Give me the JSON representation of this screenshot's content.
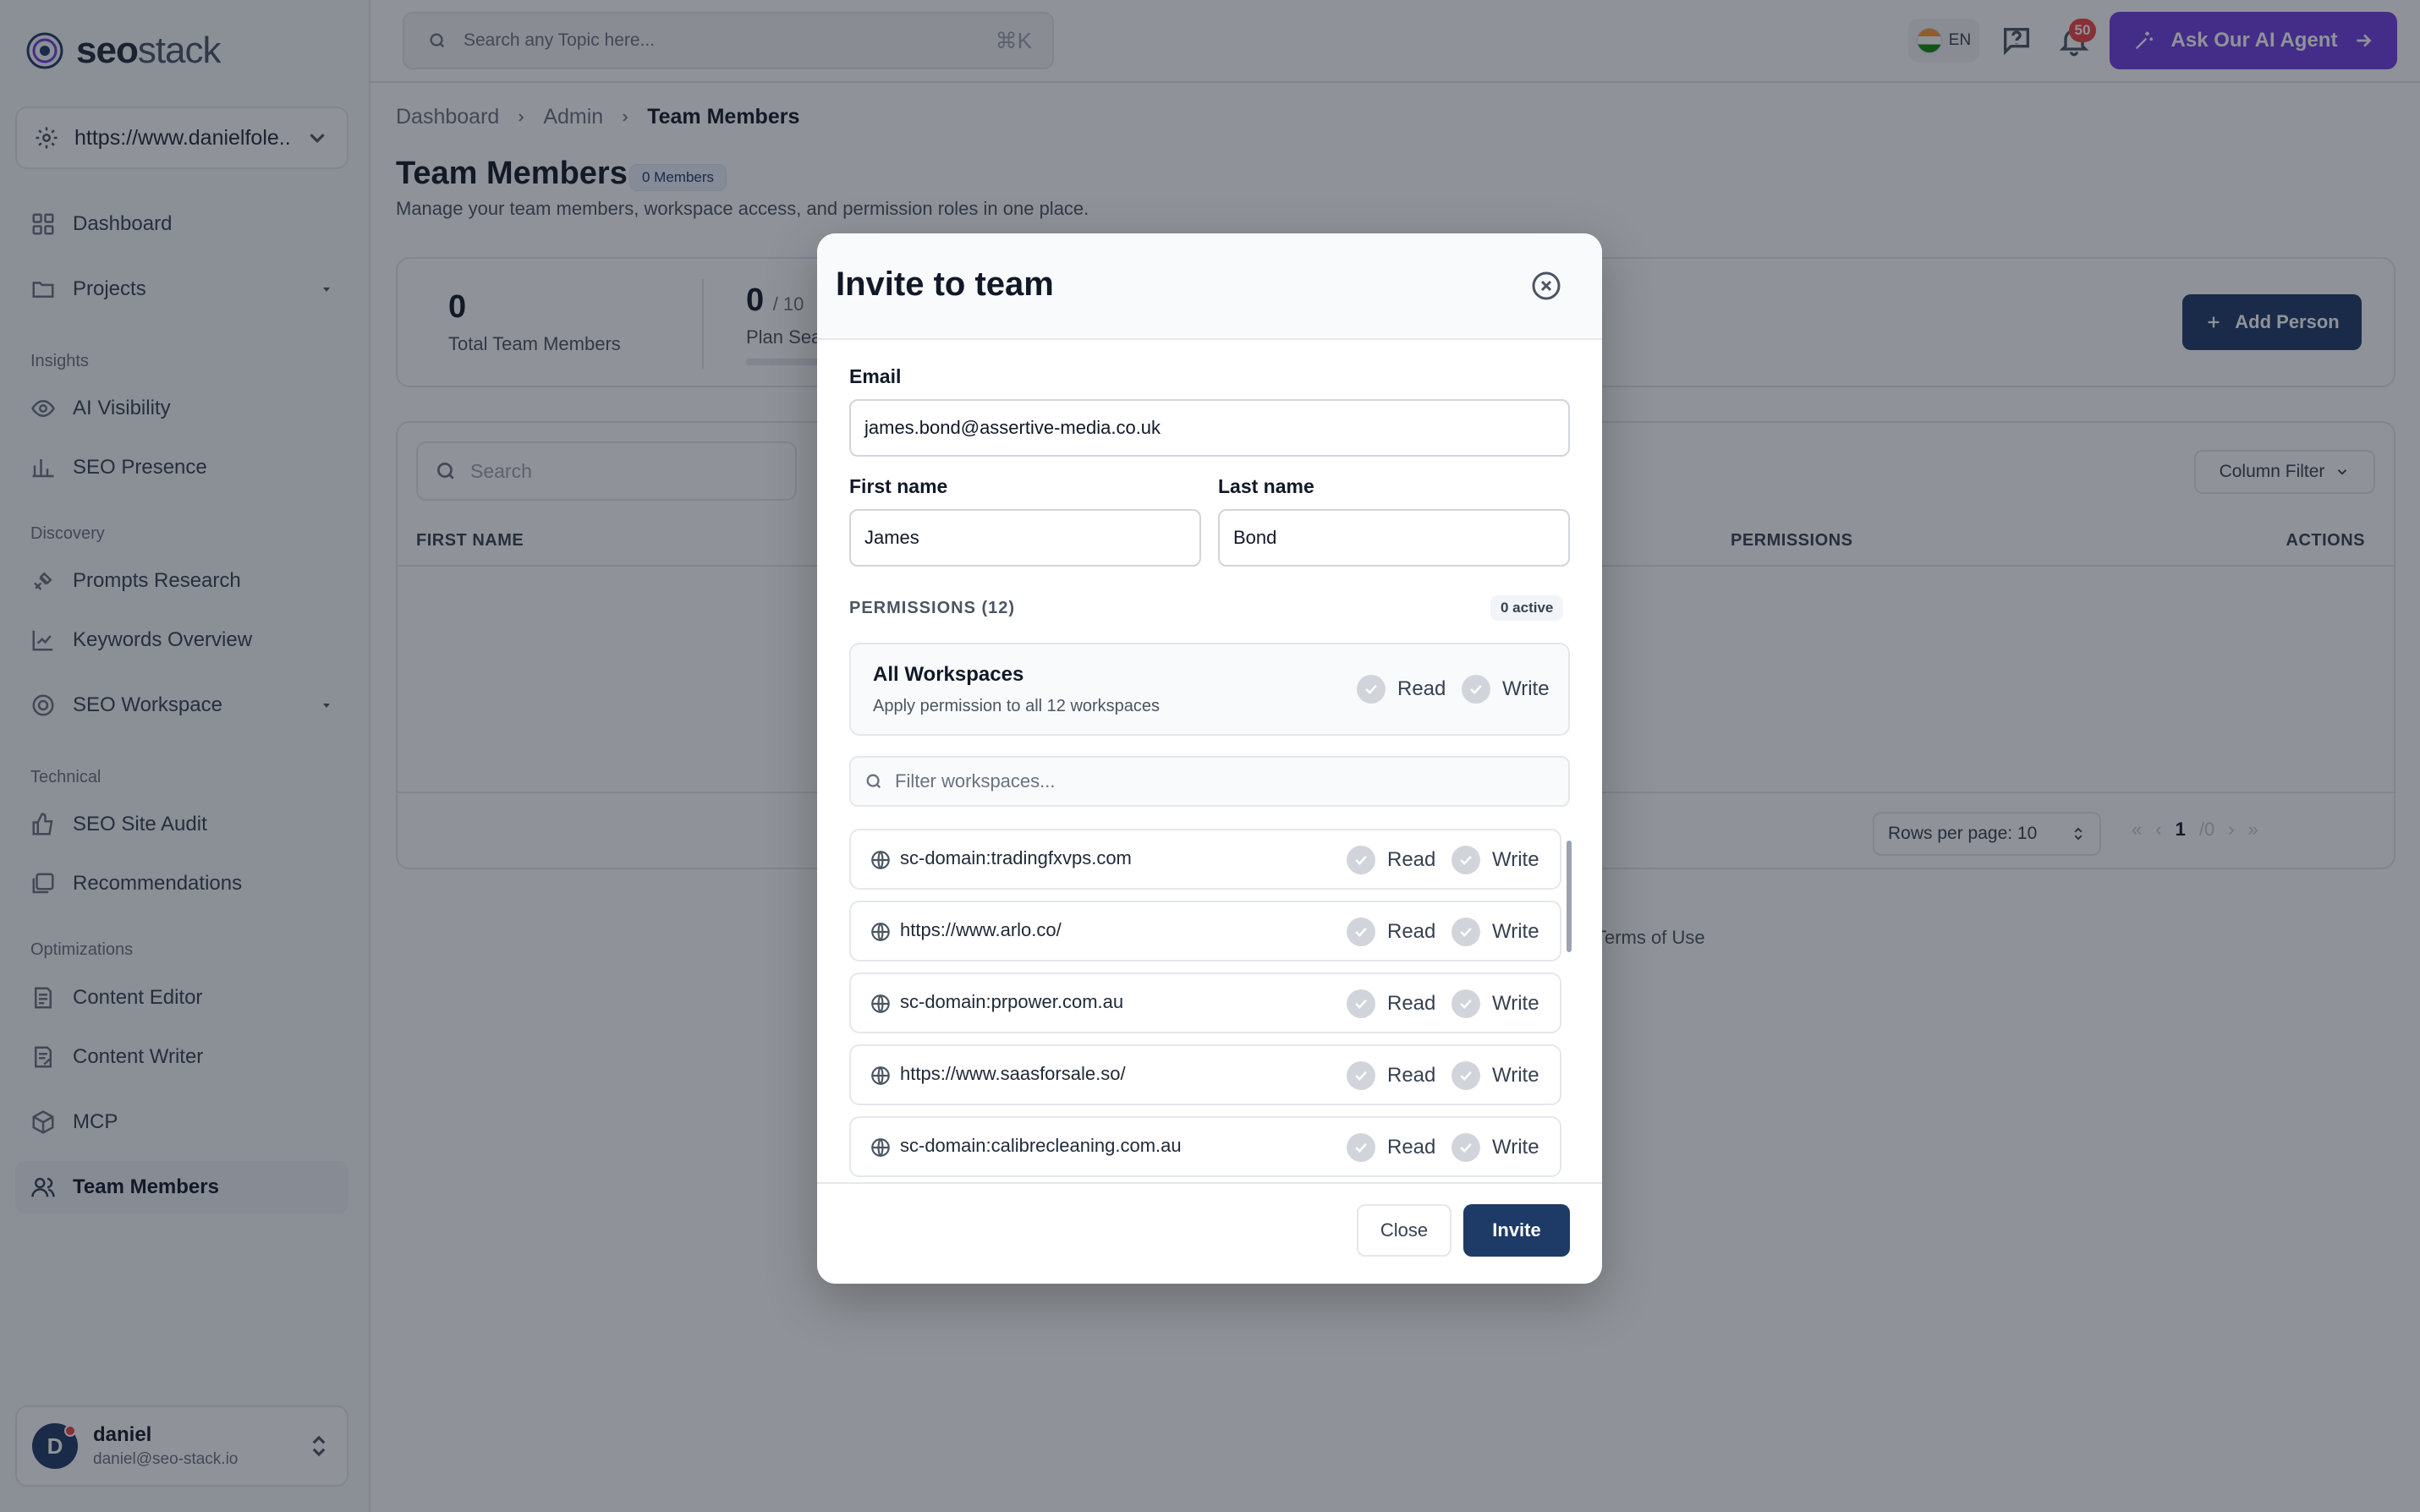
{
  "brand": {
    "name_bold": "seo",
    "name_light": "stack"
  },
  "sidebar": {
    "site_selector": "https://www.danielfole...",
    "items": [
      {
        "label": "Dashboard"
      },
      {
        "label": "Projects"
      },
      {
        "label": "AI Visibility"
      },
      {
        "label": "SEO Presence"
      },
      {
        "label": "Prompts Research"
      },
      {
        "label": "Keywords Overview"
      },
      {
        "label": "SEO Workspace"
      },
      {
        "label": "SEO Site Audit"
      },
      {
        "label": "Recommendations"
      },
      {
        "label": "Content Editor"
      },
      {
        "label": "Content Writer"
      },
      {
        "label": "MCP"
      },
      {
        "label": "Team Members"
      }
    ],
    "sections": {
      "insights": "Insights",
      "discovery": "Discovery",
      "technical": "Technical",
      "optimizations": "Optimizations"
    },
    "user": {
      "initial": "D",
      "name": "daniel",
      "email": "daniel@seo-stack.io"
    }
  },
  "topbar": {
    "search_placeholder": "Search any Topic here...",
    "shortcut": "⌘K",
    "language": "EN",
    "notification_count": "50",
    "ai_button": "Ask Our AI Agent"
  },
  "breadcrumb": [
    "Dashboard",
    "Admin",
    "Team Members"
  ],
  "page": {
    "title": "Team Members",
    "members_badge": "0 Members",
    "subtitle": "Manage your team members, workspace access, and permission roles in one place."
  },
  "stats": {
    "total_value": "0",
    "total_label": "Total Team Members",
    "seats_value": "0",
    "seats_of": "/ 10",
    "seats_label": "Plan Sea",
    "add_button": "Add Person"
  },
  "table": {
    "search_placeholder": "Search",
    "column_filter": "Column Filter",
    "headers": {
      "first_name": "FIRST NAME",
      "permissions": "PERMISSIONS",
      "actions": "ACTIONS"
    },
    "rows_per_page": "Rows per page: 10",
    "page_current": "1",
    "page_total": "/0"
  },
  "footer": {
    "terms": "Terms of Use"
  },
  "modal": {
    "title": "Invite to team",
    "email_label": "Email",
    "email_value": "james.bond@assertive-media.co.uk",
    "first_name_label": "First name",
    "first_name_value": "James",
    "last_name_label": "Last name",
    "last_name_value": "Bond",
    "permissions_heading": "PERMISSIONS (12)",
    "active_badge": "0 active",
    "all_workspaces": {
      "title": "All Workspaces",
      "subtitle": "Apply permission to all 12 workspaces",
      "read": "Read",
      "write": "Write"
    },
    "filter_placeholder": "Filter workspaces...",
    "workspaces": [
      {
        "name": "sc-domain:tradingfxvps.com",
        "read": "Read",
        "write": "Write"
      },
      {
        "name": "https://www.arlo.co/",
        "read": "Read",
        "write": "Write"
      },
      {
        "name": "sc-domain:prpower.com.au",
        "read": "Read",
        "write": "Write"
      },
      {
        "name": "https://www.saasforsale.so/",
        "read": "Read",
        "write": "Write"
      },
      {
        "name": "sc-domain:calibrecleaning.com.au",
        "read": "Read",
        "write": "Write"
      }
    ],
    "close_button": "Close",
    "invite_button": "Invite"
  }
}
